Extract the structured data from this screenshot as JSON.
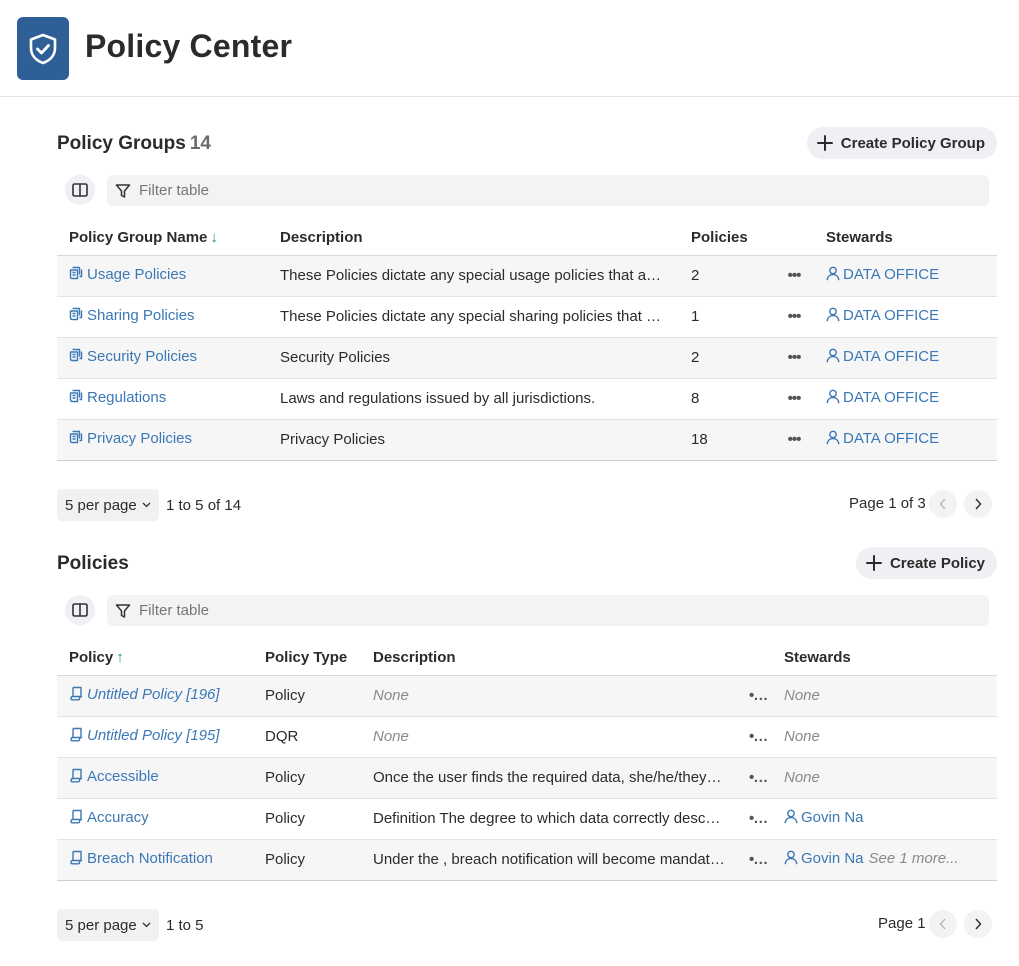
{
  "app": {
    "title": "Policy Center"
  },
  "groups": {
    "title": "Policy Groups",
    "count": "14",
    "create_label": "Create Policy Group",
    "filter_placeholder": "Filter table",
    "columns": [
      "Policy Group Name",
      "Description",
      "Policies",
      "Stewards"
    ],
    "rows": [
      {
        "name": "Usage Policies",
        "description": "These Policies dictate any special usage policies that apply to the data",
        "policies": "2",
        "steward": "DATA OFFICE"
      },
      {
        "name": "Sharing Policies",
        "description": "These Policies dictate any special sharing policies that apply to the data",
        "policies": "1",
        "steward": "DATA OFFICE"
      },
      {
        "name": "Security Policies",
        "description": "Security Policies",
        "policies": "2",
        "steward": "DATA OFFICE"
      },
      {
        "name": "Regulations",
        "description": "Laws and regulations issued by all jurisdictions.",
        "policies": "8",
        "steward": "DATA OFFICE"
      },
      {
        "name": "Privacy Policies",
        "description": "Privacy Policies",
        "policies": "18",
        "steward": "DATA OFFICE"
      }
    ],
    "per_page": "5 per page",
    "range": "1 to 5 of 14",
    "page_label": "Page 1 of 3"
  },
  "policies": {
    "title": "Policies",
    "create_label": "Create Policy",
    "filter_placeholder": "Filter table",
    "columns": [
      "Policy",
      "Policy Type",
      "Description",
      "Stewards"
    ],
    "rows": [
      {
        "name": "Untitled Policy [196]",
        "type": "Policy",
        "description": "None",
        "steward": "None",
        "more": ""
      },
      {
        "name": "Untitled Policy [195]",
        "type": "DQR",
        "description": "None",
        "steward": "None",
        "more": ""
      },
      {
        "name": "Accessible",
        "type": "Policy",
        "description": "Once the user finds the required data, she/he/they can access it",
        "steward": "None",
        "more": ""
      },
      {
        "name": "Accuracy",
        "type": "Policy",
        "description": "Definition The degree to which data correctly describes the real world",
        "steward": "Govin Na",
        "more": ""
      },
      {
        "name": "Breach Notification",
        "type": "Policy",
        "description": "Under the , breach notification will become mandatory in all member states",
        "steward": "Govin Na",
        "more": "See 1 more..."
      }
    ],
    "per_page": "5 per page",
    "range": "1 to 5",
    "page_label": "Page 1"
  },
  "icons": {
    "logo": "shield-check-icon",
    "columns": "columns-icon",
    "filter": "filter-icon",
    "group_row": "policy-group-icon",
    "policy_row": "policy-icon",
    "steward": "person-icon",
    "more": "more-options-icon"
  },
  "colors": {
    "brand": "#2f5f97",
    "link": "#3b78b5",
    "sort": "#1f8c7a"
  }
}
